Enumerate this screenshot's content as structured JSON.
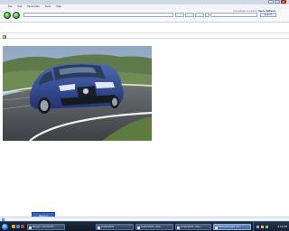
{
  "window": {
    "title": "",
    "min_label": "–",
    "max_label": "□",
    "close_label": "×"
  },
  "menu": {
    "items": [
      "File",
      "Edit",
      "Favourites",
      "Tools",
      "Help"
    ]
  },
  "toolbar": {
    "back_label": "‹",
    "forward_label": "›",
    "go_labels": [
      "",
      "",
      "",
      ""
    ],
    "search_button": "Search",
    "brand_prefix": "This software is made by",
    "brand_name": "Opera Software"
  },
  "content": {
    "photo_icon": "car-photo"
  },
  "popup": {
    "text": "Get on!"
  },
  "statusbar": {
    "zoom": ""
  },
  "taskbar": {
    "tasks": [
      {
        "label": "Blogger: Internet Ed...",
        "active": false
      },
      {
        "label": "Screenshots",
        "active": false
      },
      {
        "label": "Screenshots - Ope...",
        "active": false
      },
      {
        "label": "Screenshots - Ope...",
        "active": false
      },
      {
        "label": "InternetBrowser V1.7",
        "active": true
      }
    ],
    "clock": "3:09 PM"
  },
  "colors": {
    "accent": "#2f64c8",
    "taskbar": "#0e1726",
    "go_green": "#3fa42c"
  }
}
